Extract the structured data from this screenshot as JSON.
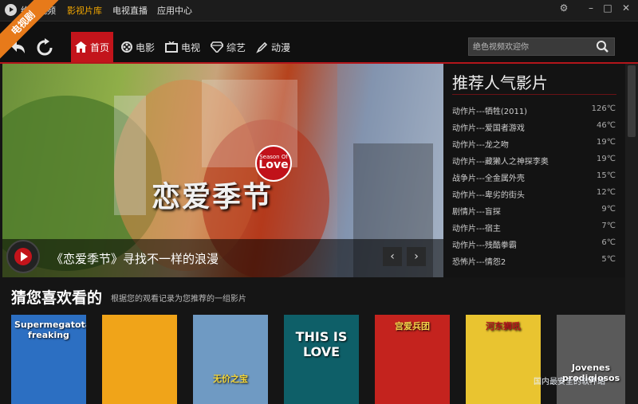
{
  "titlebar": {
    "app_name": "绝色视频",
    "menus": [
      "影视片库",
      "电视直播",
      "应用中心"
    ],
    "active_menu": "影视片库"
  },
  "nav": {
    "tabs": [
      {
        "label": "首页",
        "icon": "home-icon"
      },
      {
        "label": "电影",
        "icon": "film-reel-icon"
      },
      {
        "label": "电视",
        "icon": "tv-icon"
      },
      {
        "label": "综艺",
        "icon": "diamond-icon"
      },
      {
        "label": "动漫",
        "icon": "pen-icon"
      }
    ],
    "active_tab": "首页",
    "search_placeholder": "绝色视频欢迎你"
  },
  "banner": {
    "ribbon": "电视剧",
    "poster_title": "恋爱季节",
    "season_top": "Season Of",
    "season_big": "Love",
    "caption": "《恋爱季节》寻找不一样的浪漫"
  },
  "hot": {
    "title": "推荐人气影片",
    "items": [
      {
        "name": "动作片---牺牲(2011)",
        "temp": "126℃"
      },
      {
        "name": "动作片---爱国者游戏",
        "temp": "46℃"
      },
      {
        "name": "动作片---龙之吻",
        "temp": "19℃"
      },
      {
        "name": "动作片---藏獭人之神探李奥",
        "temp": "19℃"
      },
      {
        "name": "战争片---全金属外壳",
        "temp": "15℃"
      },
      {
        "name": "动作片---卑劣的街头",
        "temp": "12℃"
      },
      {
        "name": "剧情片---盲探",
        "temp": "9℃"
      },
      {
        "name": "动作片---宿主",
        "temp": "7℃"
      },
      {
        "name": "动作片---残酷拳霸",
        "temp": "6℃"
      },
      {
        "name": "恐怖片---情怨2",
        "temp": "5℃"
      }
    ]
  },
  "recommend": {
    "title": "猜您喜欢看的",
    "subtitle": "根据您的观看记录为您推荐的一组影片",
    "thumbs": [
      {
        "text": "Supermegatotally freaking",
        "bg": "#2c6fc2"
      },
      {
        "text": "",
        "bg": "#f0a419"
      },
      {
        "text": "无价之宝",
        "bg": "#6f9ac3"
      },
      {
        "text": "THIS IS LOVE",
        "bg": "#0e5f68"
      },
      {
        "text": "宫爱兵团",
        "bg": "#c4231e"
      },
      {
        "text": "河东狮吼",
        "bg": "#e9c430"
      },
      {
        "text": "Jovenes prodigiosos",
        "bg": "#5a5a5a"
      }
    ]
  },
  "watermark": {
    "line1": "Jovenes prodigiosos",
    "line2": "国内最安全的软件站"
  }
}
